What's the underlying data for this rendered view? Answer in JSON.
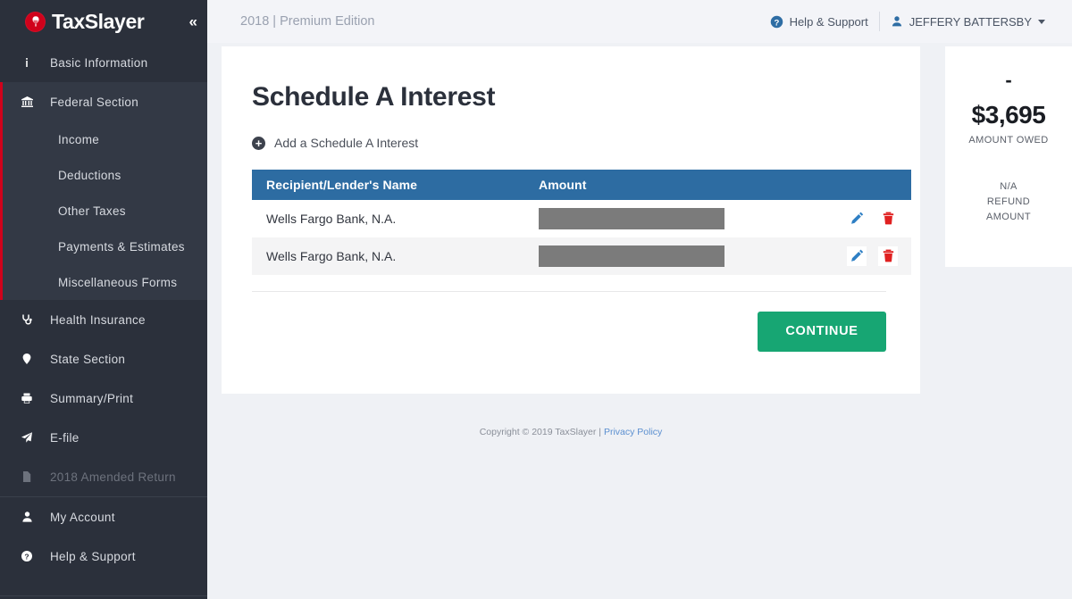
{
  "brand": {
    "name": "TaxSlayer",
    "logo_icon": "gladiator-helmet-icon",
    "logo_color": "#d0021b",
    "collapse_icon": "chevron-double-left-icon"
  },
  "sidebar": {
    "items": [
      {
        "label": "Basic Information",
        "icon": "info-icon",
        "state": "normal"
      },
      {
        "label": "Federal Section",
        "icon": "bank-icon",
        "state": "expanded"
      },
      {
        "label": "Health Insurance",
        "icon": "stethoscope-icon",
        "state": "normal"
      },
      {
        "label": "State Section",
        "icon": "map-pin-icon",
        "state": "normal"
      },
      {
        "label": "Summary/Print",
        "icon": "printer-icon",
        "state": "normal"
      },
      {
        "label": "E-file",
        "icon": "paper-plane-icon",
        "state": "normal"
      },
      {
        "label": "2018 Amended Return",
        "icon": "document-icon",
        "state": "disabled"
      },
      {
        "label": "My Account",
        "icon": "user-icon",
        "state": "normal"
      },
      {
        "label": "Help & Support",
        "icon": "question-circle-icon",
        "state": "normal"
      }
    ],
    "federal_subitems": [
      {
        "label": "Income"
      },
      {
        "label": "Deductions"
      },
      {
        "label": "Other Taxes"
      },
      {
        "label": "Payments & Estimates"
      },
      {
        "label": "Miscellaneous Forms"
      }
    ],
    "active_accent_color": "#d0021b"
  },
  "topbar": {
    "title": "2018 | Premium Edition",
    "help_label": "Help & Support",
    "help_icon": "question-circle-icon",
    "user_name": "JEFFERY BATTERSBY",
    "user_icon": "user-icon",
    "caret_icon": "caret-down-icon"
  },
  "main": {
    "page_title": "Schedule A Interest",
    "add_label": "Add a Schedule A Interest",
    "add_icon": "plus-circle-icon",
    "table": {
      "header_color": "#2d6ca2",
      "columns": [
        "Recipient/Lender's Name",
        "Amount",
        ""
      ],
      "rows": [
        {
          "name": "Wells Fargo Bank, N.A.",
          "amount": "",
          "amount_redacted": true,
          "edit_icon": "pencil-icon",
          "delete_icon": "trash-icon"
        },
        {
          "name": "Wells Fargo Bank, N.A.",
          "amount": "",
          "amount_redacted": true,
          "edit_icon": "pencil-icon",
          "delete_icon": "trash-icon"
        }
      ]
    },
    "continue_label": "CONTINUE",
    "continue_color": "#17a673"
  },
  "refund_panel": {
    "dash": "-",
    "amount": "$3,695",
    "amount_label": "AMOUNT OWED",
    "refund_value": "N/A",
    "refund_label_line1": "REFUND",
    "refund_label_line2": "AMOUNT"
  },
  "footer": {
    "copyright": "Copyright © 2019 TaxSlayer | ",
    "privacy_link": "Privacy Policy"
  }
}
